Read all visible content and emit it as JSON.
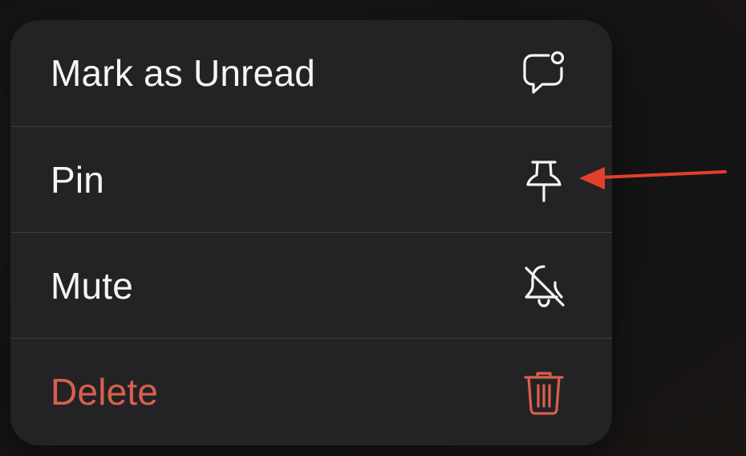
{
  "menu": {
    "items": [
      {
        "label": "Mark as Unread",
        "icon": "unread-message-icon",
        "style": "default"
      },
      {
        "label": "Pin",
        "icon": "pin-icon",
        "style": "default"
      },
      {
        "label": "Mute",
        "icon": "bell-slash-icon",
        "style": "default"
      },
      {
        "label": "Delete",
        "icon": "trash-icon",
        "style": "destructive"
      }
    ]
  },
  "colors": {
    "menu_background": "#232325",
    "text": "#f5f5f7",
    "destructive": "#d9604d",
    "annotation_arrow": "#e2402a",
    "divider": "#3b3b3e"
  },
  "annotation": {
    "type": "arrow",
    "points_to": "pin-icon"
  }
}
